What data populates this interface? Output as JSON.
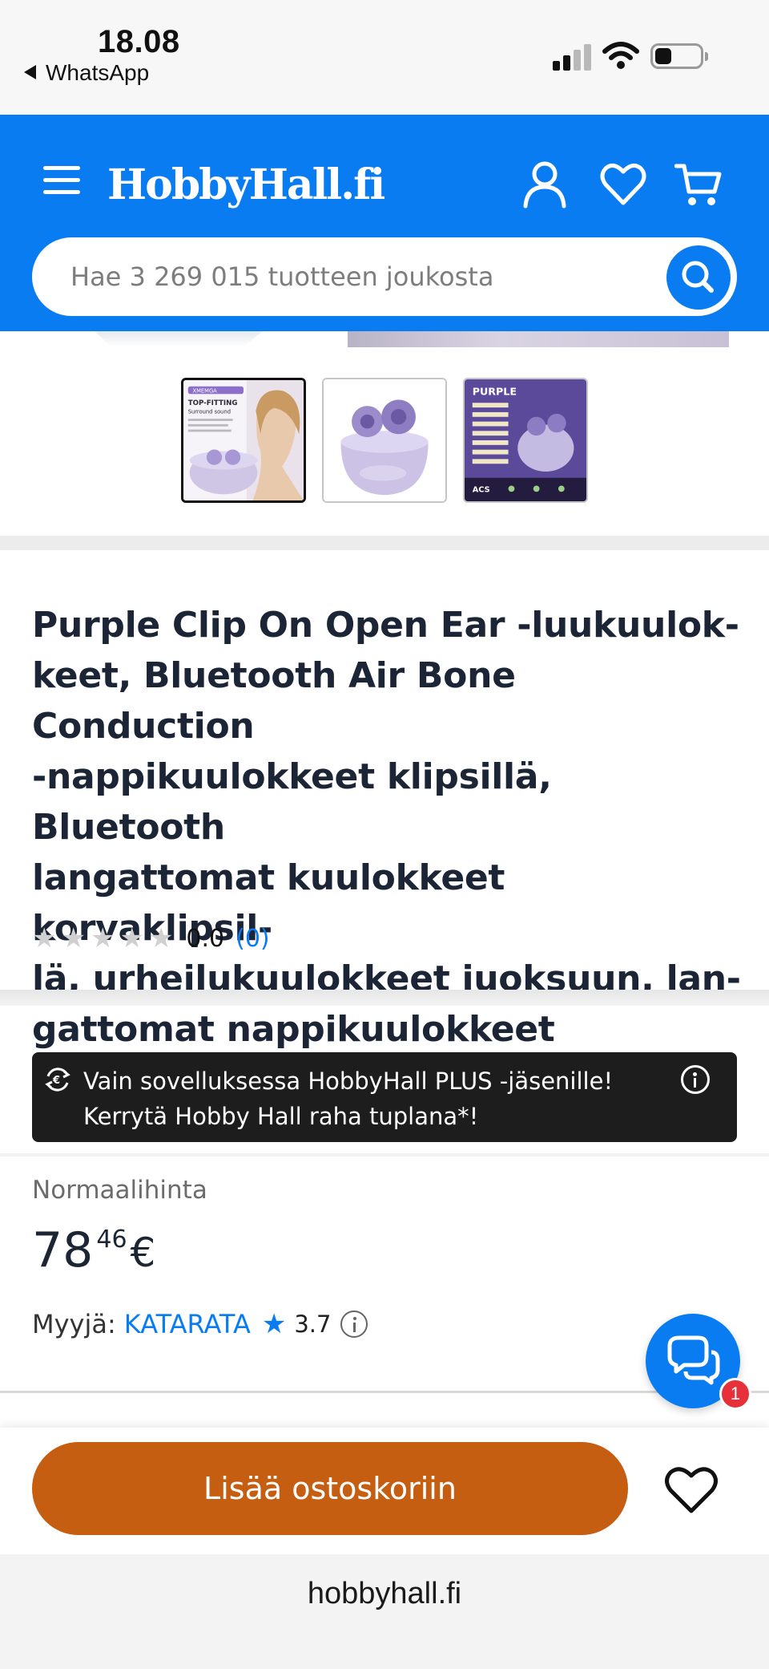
{
  "status_bar": {
    "time": "18.08",
    "back_app": "WhatsApp"
  },
  "header": {
    "logo": "HobbyHall.fi",
    "search_placeholder": "Hae 3 269 015 tuotteen joukosta"
  },
  "product": {
    "title": "Purple Clip On Open Ear -luukuulok-keet, Bluetooth Air Bone Conduction -nappikuulokkeet klipsillä, Bluetooth langattomat kuulokkeet korvaklipsil-lä, urheilukuulokkeet juoksuun, lan-gattomat nappikuulokkeet",
    "title_lines": [
      "Purple Clip On Open Ear -luukuulok-",
      "keet, Bluetooth Air Bone Conduction",
      "-nappikuulokkeet klipsillä, Bluetooth",
      "langattomat kuulokkeet korvaklipsil-",
      "lä, urheilukuulokkeet juoksuun, lan-",
      "gattomat nappikuulokkeet"
    ],
    "rating_value": "0.0",
    "rating_count": "(0)",
    "stars_filled": 0,
    "stars_total": 5
  },
  "thumbnails": {
    "thumb1_badge": "XMEMGA",
    "thumb1_heading": "TOP-FITTING",
    "thumb1_sub": "Surround sound",
    "thumb3_heading": "PURPLE",
    "thumb3_footer": "ACS"
  },
  "promo": {
    "line1": "Vain sovelluksessa HobbyHall PLUS -jäsenille!",
    "line2": "Kerrytä Hobby Hall raha tuplana*!"
  },
  "price": {
    "label": "Normaalihinta",
    "whole": "78",
    "cents": "46",
    "currency": "€"
  },
  "seller": {
    "label": "Myyjä:",
    "name": "KATARATA",
    "rating": "3.7"
  },
  "chat": {
    "badge_count": "1"
  },
  "cart": {
    "add_label": "Lisää ostoskoriin"
  },
  "browser": {
    "url": "hobbyhall.fi"
  },
  "colors": {
    "brand_blue": "#0a7cf2",
    "cart_orange": "#c55e11",
    "promo_bg": "#1d1d1d",
    "badge_red": "#e8303a"
  }
}
